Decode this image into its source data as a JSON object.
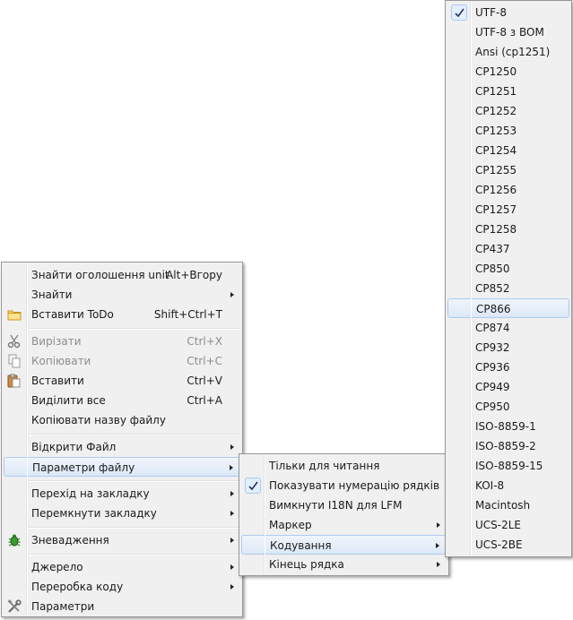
{
  "main_menu": {
    "items": [
      {
        "label": "Знайти оголошення unit",
        "shortcut": "Alt+Вгору"
      },
      {
        "label": "Знайти"
      },
      {
        "label": "Вставити ToDo",
        "shortcut": "Shift+Ctrl+T"
      },
      {
        "label": "Вирізати",
        "shortcut": "Ctrl+X"
      },
      {
        "label": "Копіювати",
        "shortcut": "Ctrl+C"
      },
      {
        "label": "Вставити",
        "shortcut": "Ctrl+V"
      },
      {
        "label": "Виділити все",
        "shortcut": "Ctrl+A"
      },
      {
        "label": "Копіювати назву файлу"
      },
      {
        "label": "Відкрити Файл"
      },
      {
        "label": "Параметри файлу"
      },
      {
        "label": "Перехід на закладку"
      },
      {
        "label": "Перемкнути закладку"
      },
      {
        "label": "Зневадження"
      },
      {
        "label": "Джерело"
      },
      {
        "label": "Переробка коду"
      },
      {
        "label": "Параметри"
      }
    ]
  },
  "file_params_menu": {
    "items": [
      {
        "label": "Тільки для читання"
      },
      {
        "label": "Показувати нумерацію рядків"
      },
      {
        "label": "Вимкнути I18N для LFM"
      },
      {
        "label": "Маркер"
      },
      {
        "label": "Кодування"
      },
      {
        "label": "Кінець рядка"
      }
    ]
  },
  "encoding_menu": {
    "items": [
      "UTF-8",
      "UTF-8 з BOM",
      "Ansi (cp1251)",
      "CP1250",
      "CP1251",
      "CP1252",
      "CP1253",
      "CP1254",
      "CP1255",
      "CP1256",
      "CP1257",
      "CP1258",
      "CP437",
      "CP850",
      "CP852",
      "CP866",
      "CP874",
      "CP932",
      "CP936",
      "CP949",
      "CP950",
      "ISO-8859-1",
      "ISO-8859-2",
      "ISO-8859-15",
      "KOI-8",
      "Macintosh",
      "UCS-2LE",
      "UCS-2BE"
    ],
    "selected": "UTF-8",
    "hovered": "CP866"
  }
}
